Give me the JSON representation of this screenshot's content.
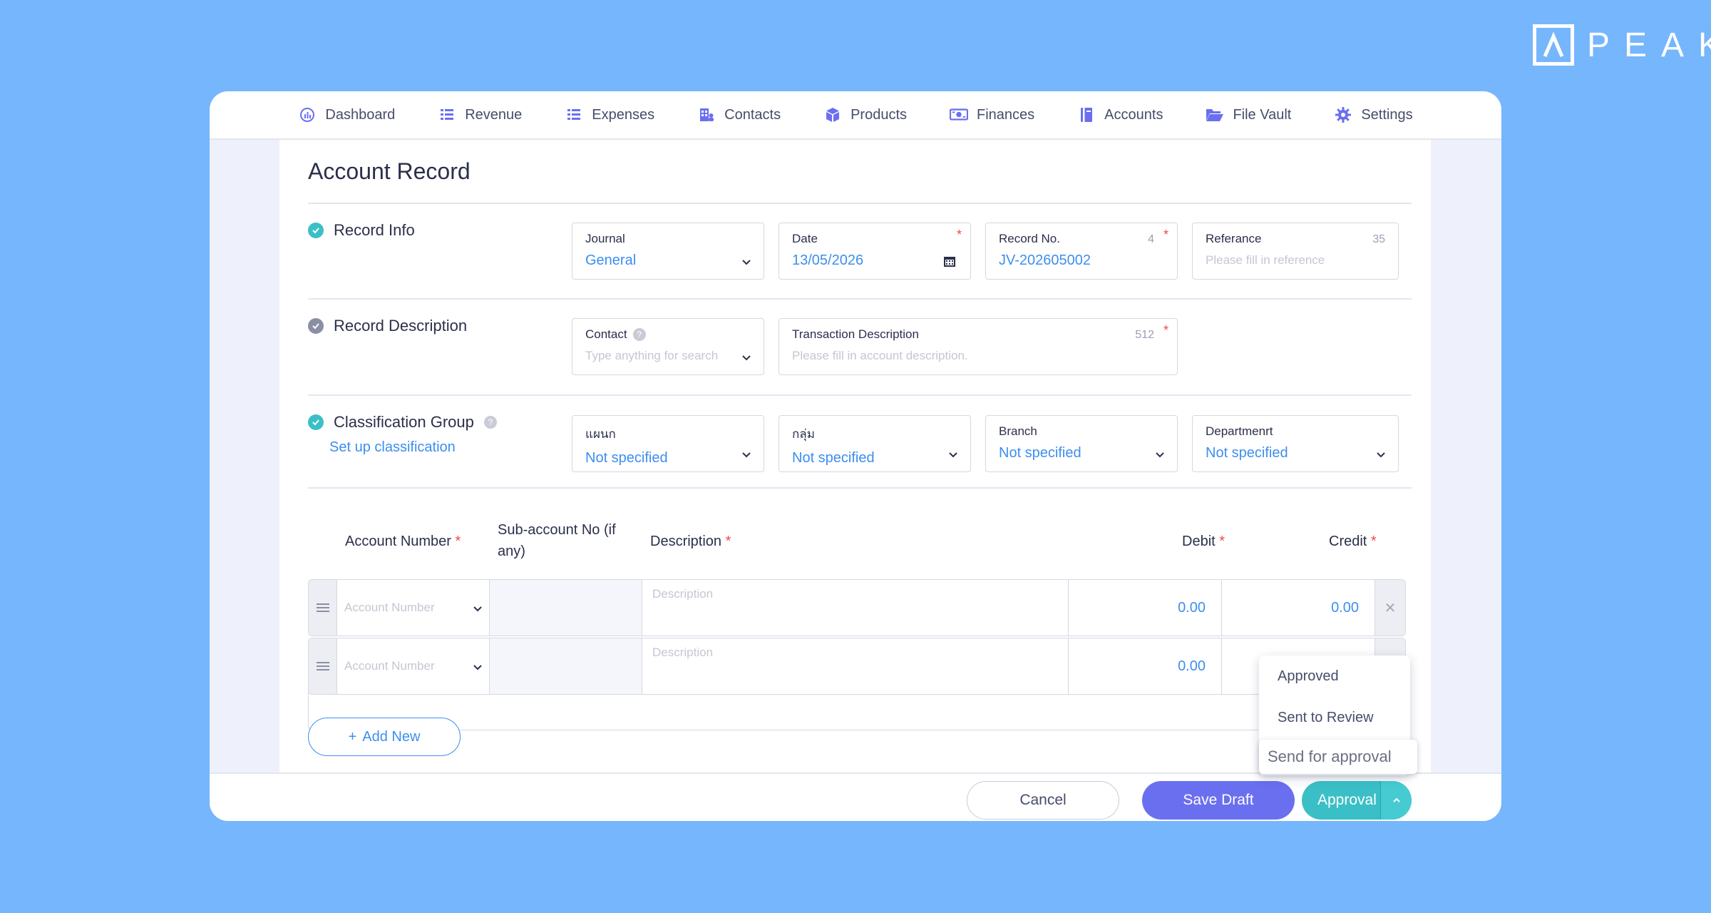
{
  "brand": {
    "name": "PEAK"
  },
  "nav": [
    {
      "label": "Dashboard",
      "icon": "dashboard-icon"
    },
    {
      "label": "Revenue",
      "icon": "revenue-icon"
    },
    {
      "label": "Expenses",
      "icon": "expenses-icon"
    },
    {
      "label": "Contacts",
      "icon": "contacts-icon"
    },
    {
      "label": "Products",
      "icon": "products-icon"
    },
    {
      "label": "Finances",
      "icon": "finances-icon"
    },
    {
      "label": "Accounts",
      "icon": "accounts-icon"
    },
    {
      "label": "File Vault",
      "icon": "folder-icon"
    },
    {
      "label": "Settings",
      "icon": "gear-icon"
    }
  ],
  "page": {
    "title": "Account Record"
  },
  "record_info": {
    "label": "Record Info",
    "journal": {
      "label": "Journal",
      "value": "General"
    },
    "date": {
      "label": "Date",
      "value": "13/05/2026"
    },
    "record_no": {
      "label": "Record No.",
      "value": "JV-202605002",
      "count": "4"
    },
    "reference": {
      "label": "Referance",
      "placeholder": "Please fill in reference",
      "count": "35"
    }
  },
  "record_description": {
    "label": "Record Description",
    "contact": {
      "label": "Contact",
      "placeholder": "Type anything for search"
    },
    "transaction": {
      "label": "Transaction Description",
      "placeholder": "Please fill in account description.",
      "count": "512"
    }
  },
  "classification": {
    "label": "Classification Group",
    "setup_link": "Set up classification",
    "fields": [
      {
        "label": "แผนก",
        "value": "Not specified"
      },
      {
        "label": "กลุ่ม",
        "value": "Not specified"
      },
      {
        "label": "Branch",
        "value": "Not specified"
      },
      {
        "label": "Departmenrt",
        "value": "Not specified"
      }
    ]
  },
  "table": {
    "headers": {
      "account_number": "Account Number",
      "sub_account_line1": "Sub-account No (if",
      "sub_account_line2": "any)",
      "description": "Description",
      "debit": "Debit",
      "credit": "Credit"
    },
    "required_mark": "*",
    "rows": [
      {
        "account_placeholder": "Account Number",
        "description_placeholder": "Description",
        "debit": "0.00",
        "credit": "0.00"
      },
      {
        "account_placeholder": "Account Number",
        "description_placeholder": "Description",
        "debit": "0.00"
      }
    ],
    "add_label": "Add New"
  },
  "footer": {
    "cancel": "Cancel",
    "save_draft": "Save Draft",
    "approval": "Approval"
  },
  "approval_menu": [
    "Approved",
    "Sent to Review",
    "Send for approval"
  ],
  "colors": {
    "accent_blue": "#3d8ef0",
    "teal": "#3bbfc7",
    "purple": "#6a6ff0",
    "background": "#76b6fc"
  }
}
